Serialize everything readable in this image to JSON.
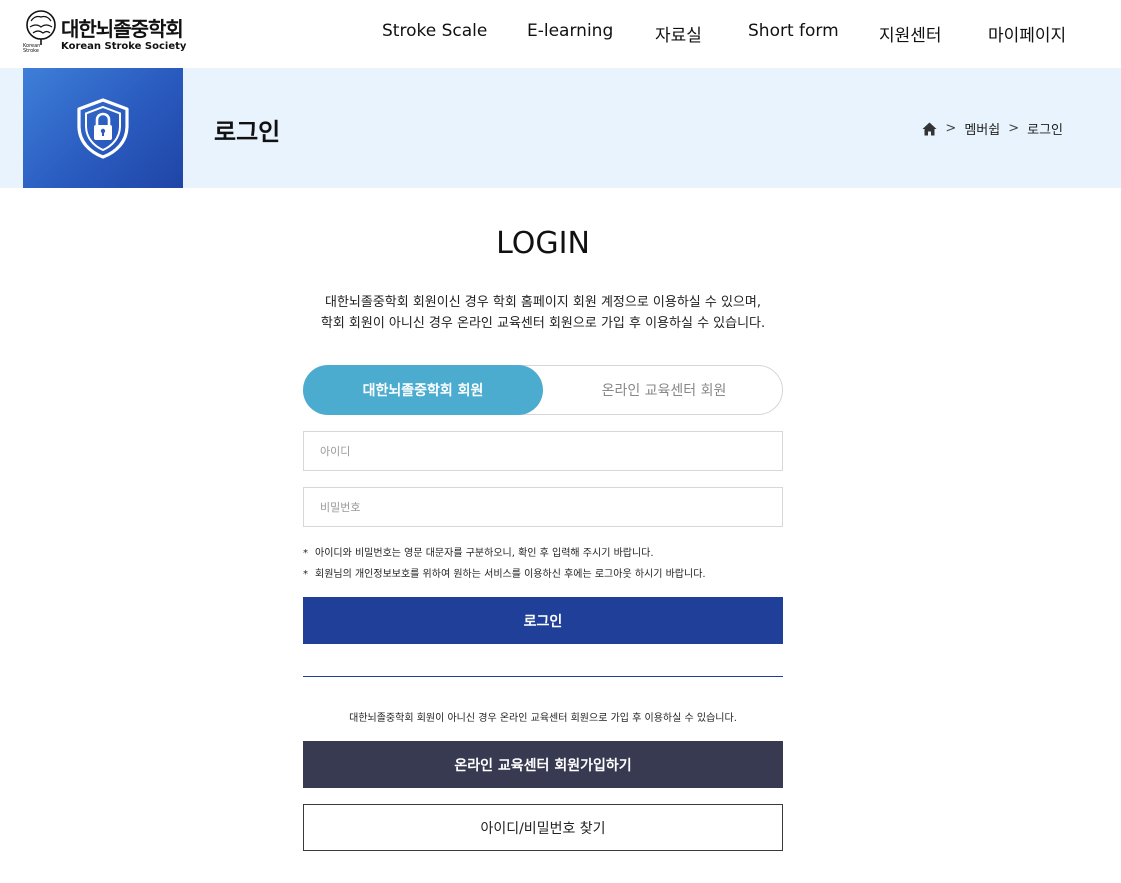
{
  "header": {
    "logo_title": "대한뇌졸중학회",
    "logo_subtitle": "Korean Stroke Society",
    "nav": [
      {
        "label": "Stroke Scale"
      },
      {
        "label": "E-learning"
      },
      {
        "label": "자료실"
      },
      {
        "label": "Short form"
      },
      {
        "label": "지원센터"
      },
      {
        "label": "마이페이지"
      }
    ]
  },
  "banner": {
    "title": "로그인",
    "icon": "shield-lock-icon",
    "breadcrumb": {
      "home_icon": "home-icon",
      "items": [
        "멤버쉽",
        "로그인"
      ],
      "separator": ">"
    }
  },
  "login": {
    "heading": "LOGIN",
    "intro_line1": "대한뇌졸중학회 회원이신 경우 학회 홈페이지 회원 계정으로 이용하실 수 있으며,",
    "intro_line2": "학회 회원이 아니신 경우 온라인 교육센터 회원으로 가입 후 이용하실 수 있습니다.",
    "tabs": {
      "active": "대한뇌졸중학회 회원",
      "inactive": "온라인 교육센터 회원"
    },
    "id_placeholder": "아이디",
    "password_placeholder": "비밀번호",
    "notes": [
      "아이디와 비밀번호는 영문 대문자를 구분하오니, 확인 후 입력해 주시기 바랍니다.",
      "회원님의 개인정보보호를 위하여 원하는 서비스를 이용하신 후에는 로그아웃 하시기 바랍니다."
    ],
    "note_marker": "*",
    "login_button": "로그인",
    "signup_note": "대한뇌졸중학회 회원이 아니신 경우 온라인 교육센터 회원으로 가입 후 이용하실 수 있습니다.",
    "signup_button": "온라인 교육센터 회원가입하기",
    "find_button": "아이디/비밀번호 찾기"
  },
  "colors": {
    "banner_bg": "#e8f3fd",
    "tab_active": "#4cacd0",
    "login_button": "#1f3f99",
    "signup_button": "#383a52"
  }
}
